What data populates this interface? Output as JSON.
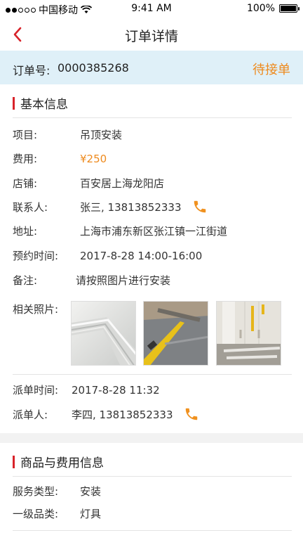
{
  "status_bar": {
    "carrier": "中国移动",
    "time": "9:41 AM",
    "battery": "100%"
  },
  "nav": {
    "title": "订单详情"
  },
  "order": {
    "label": "订单号:",
    "number": "0000385268",
    "status": "待接单",
    "status_color": "#ee8a1d"
  },
  "basic": {
    "title": "基本信息",
    "rows": [
      {
        "label": "项目:",
        "value": "吊顶安装"
      },
      {
        "label": "费用:",
        "value": "¥250"
      },
      {
        "label": "店铺:",
        "value": "百安居上海龙阳店"
      },
      {
        "label": "联系人:",
        "value": "张三, 13813852333"
      },
      {
        "label": "地址:",
        "value": "上海市浦东新区张江镇一江街道"
      },
      {
        "label": "预约时间:",
        "value": "2017-8-28 14:00-16:00"
      },
      {
        "label": "备注:",
        "value": "请按照图片进行安装"
      }
    ],
    "photos_label": "相关照片:",
    "photos": [
      "ceiling-photo",
      "floor-photo",
      "wall-pipes-photo"
    ],
    "dispatch_time_label": "派单时间:",
    "dispatch_time": "2017-8-28 11:32",
    "dispatcher_label": "派单人:",
    "dispatcher": "李四, 13813852333"
  },
  "goods": {
    "title": "商品与费用信息",
    "rows": [
      {
        "label": "服务类型:",
        "value": "安装"
      },
      {
        "label": "一级品类:",
        "value": "灯具"
      }
    ]
  },
  "colors": {
    "accent_red": "#d8232a",
    "accent_orange": "#ee8a1d",
    "order_bar_bg": "#dff0f8"
  }
}
